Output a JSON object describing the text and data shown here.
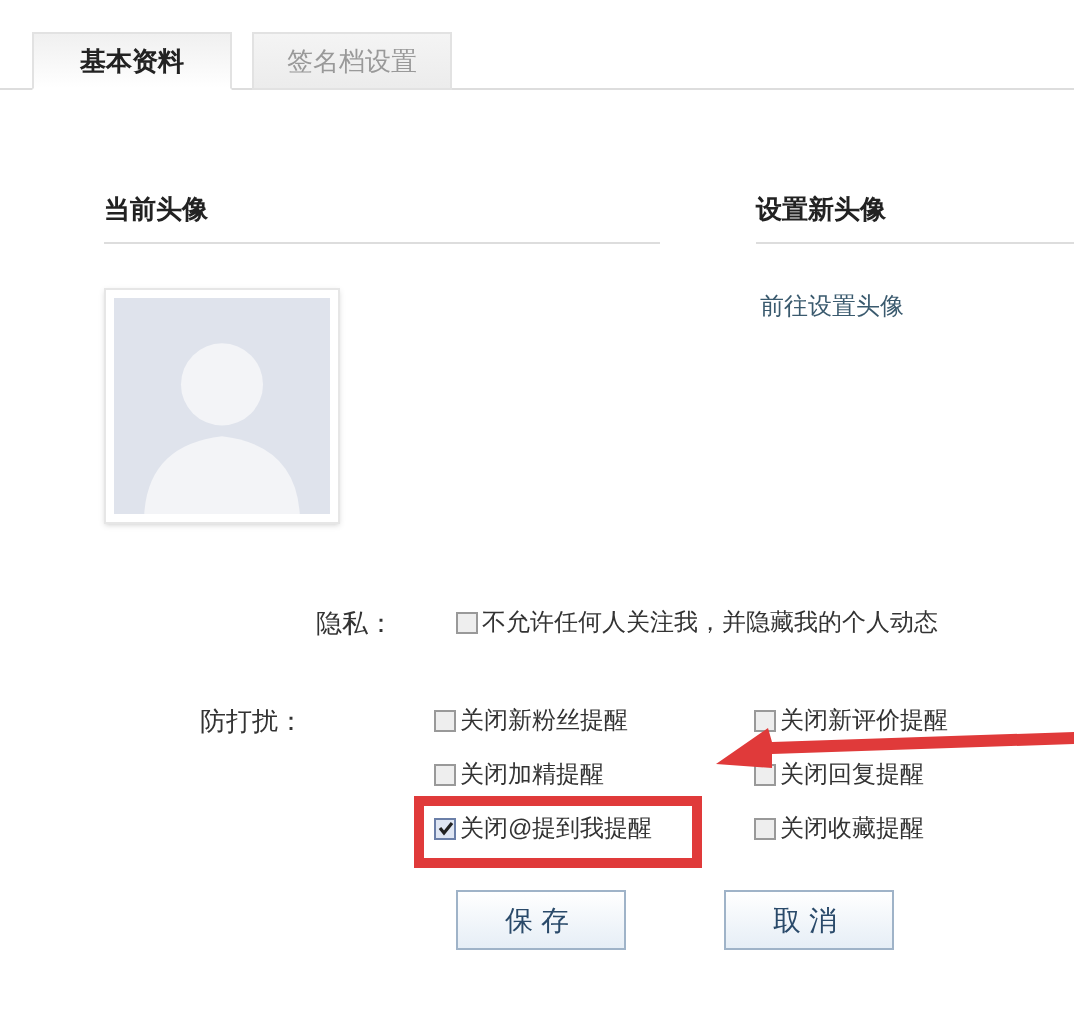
{
  "tabs": [
    {
      "label": "基本资料",
      "selected": true
    },
    {
      "label": "签名档设置",
      "selected": false
    }
  ],
  "current_avatar": {
    "heading": "当前头像"
  },
  "new_avatar": {
    "heading": "设置新头像",
    "link": "前往设置头像"
  },
  "privacy": {
    "label": "隐私：",
    "options": [
      {
        "label": "不允许任何人关注我，并隐藏我的个人动态",
        "checked": false
      }
    ]
  },
  "do_not_disturb": {
    "label": "防打扰：",
    "options": [
      {
        "label": "关闭新粉丝提醒",
        "checked": false
      },
      {
        "label": "关闭新评价提醒",
        "checked": false
      },
      {
        "label": "关闭加精提醒",
        "checked": false
      },
      {
        "label": "关闭回复提醒",
        "checked": false
      },
      {
        "label": "关闭@提到我提醒",
        "checked": true,
        "highlighted": true
      },
      {
        "label": "关闭收藏提醒",
        "checked": false
      }
    ]
  },
  "buttons": [
    "保存",
    "取消"
  ]
}
